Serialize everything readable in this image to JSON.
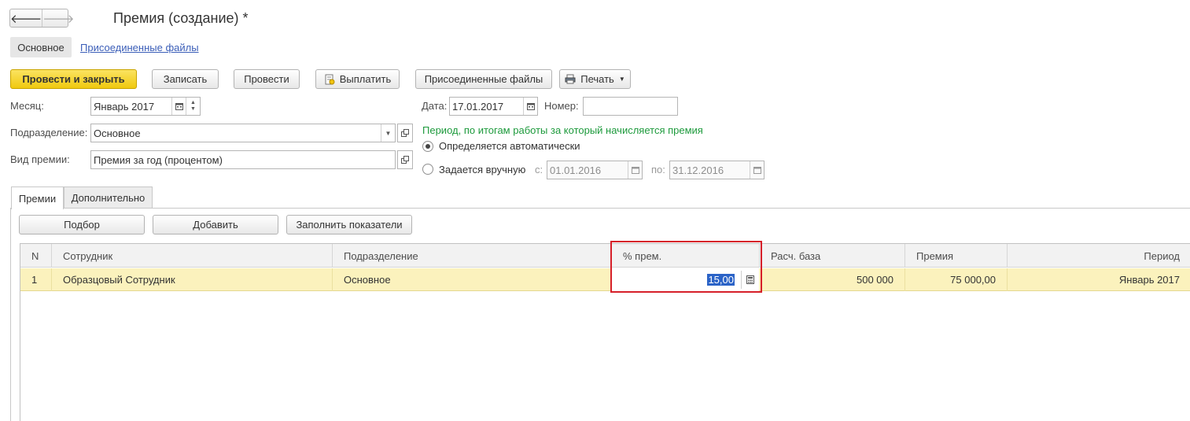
{
  "window": {
    "title": "Премия (создание) *"
  },
  "nav": {
    "back_glyph": "🡐",
    "forward_glyph": "🡒"
  },
  "form_tabs": {
    "main": "Основное",
    "files_link": "Присоединенные файлы"
  },
  "toolbar": {
    "post_and_close": "Провести и закрыть",
    "save": "Записать",
    "post": "Провести",
    "pay": "Выплатить",
    "attached_files": "Присоединенные файлы",
    "print": "Печать"
  },
  "fields": {
    "month_label": "Месяц:",
    "month_value": "Январь 2017",
    "date_label": "Дата:",
    "date_value": "17.01.2017",
    "number_label": "Номер:",
    "number_value": "",
    "department_label": "Подразделение:",
    "department_value": "Основное",
    "bonus_type_label": "Вид премии:",
    "bonus_type_value": "Премия за год (процентом)"
  },
  "period": {
    "note": "Период, по итогам работы за который начисляется премия",
    "auto_label": "Определяется автоматически",
    "manual_label": "Задается вручную",
    "from_label": "с:",
    "from_value": "01.01.2016",
    "to_label": "по:",
    "to_value": "31.12.2016",
    "selected": "auto"
  },
  "tabs": [
    {
      "label": "Премии",
      "active": true
    },
    {
      "label": "Дополнительно",
      "active": false
    }
  ],
  "table_toolbar": {
    "pick": "Подбор",
    "add": "Добавить",
    "fill": "Заполнить показатели"
  },
  "table": {
    "columns": [
      "N",
      "Сотрудник",
      "Подразделение",
      "% прем.",
      "Расч. база",
      "Премия",
      "Период"
    ],
    "rows": [
      {
        "n": "1",
        "employee": "Образцовый Сотрудник",
        "department": "Основное",
        "percent": "15,00",
        "base": "500 000",
        "bonus": "75 000,00",
        "period": "Январь 2017"
      }
    ]
  },
  "colors": {
    "primary_button": "#f5d01e",
    "selected_row": "#fbf2bd",
    "highlight_box": "#d6202a",
    "hint_text": "#1d9a3c",
    "link": "#3b5eb8"
  }
}
